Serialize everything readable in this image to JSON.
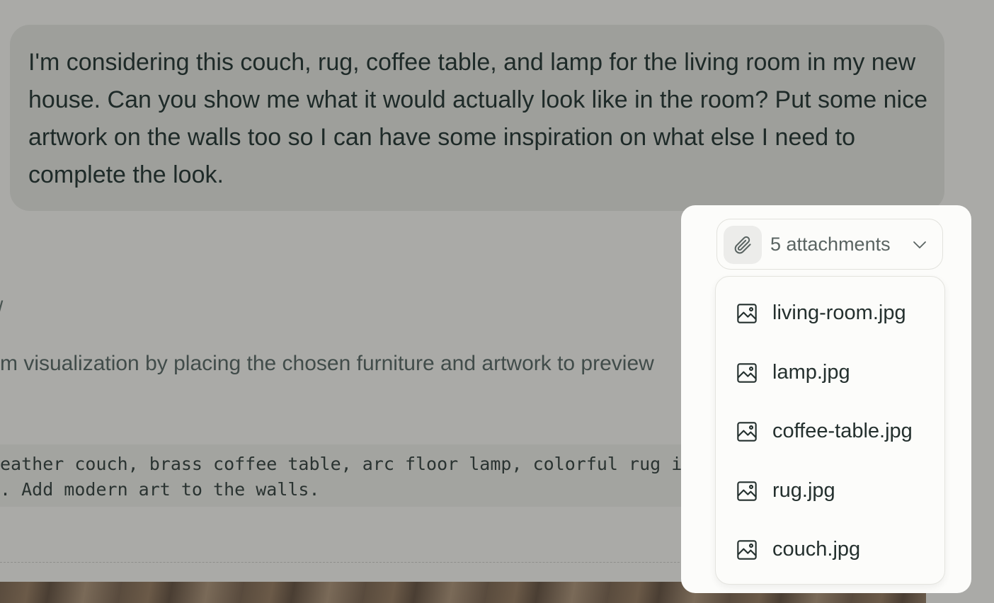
{
  "user_message": {
    "text": "I'm considering this couch, rug, coffee table, and lamp for the living room in my new house. Can you show me what it would actually look like in the room? Put some nice artwork on the walls too so I can have some inspiration on what else I need to complete the look."
  },
  "response": {
    "stray_mark": "/",
    "description": "m visualization by placing the chosen furniture and artwork to preview",
    "code_lines": [
      "eather couch, brass coffee table, arc floor lamp, colorful rug i",
      ". Add modern art to the walls."
    ]
  },
  "attachments": {
    "toggle_label": "5 attachments",
    "clip_icon": "paperclip-icon",
    "chevron_icon": "chevron-down-icon",
    "files": [
      {
        "name": "living-room.jpg",
        "icon": "image-icon"
      },
      {
        "name": "lamp.jpg",
        "icon": "image-icon"
      },
      {
        "name": "coffee-table.jpg",
        "icon": "image-icon"
      },
      {
        "name": "rug.jpg",
        "icon": "image-icon"
      },
      {
        "name": "couch.jpg",
        "icon": "image-icon"
      }
    ]
  },
  "colors": {
    "backdrop": "#aaaaa7",
    "popup_bg": "#fcfcfa",
    "text": "#24302e"
  }
}
